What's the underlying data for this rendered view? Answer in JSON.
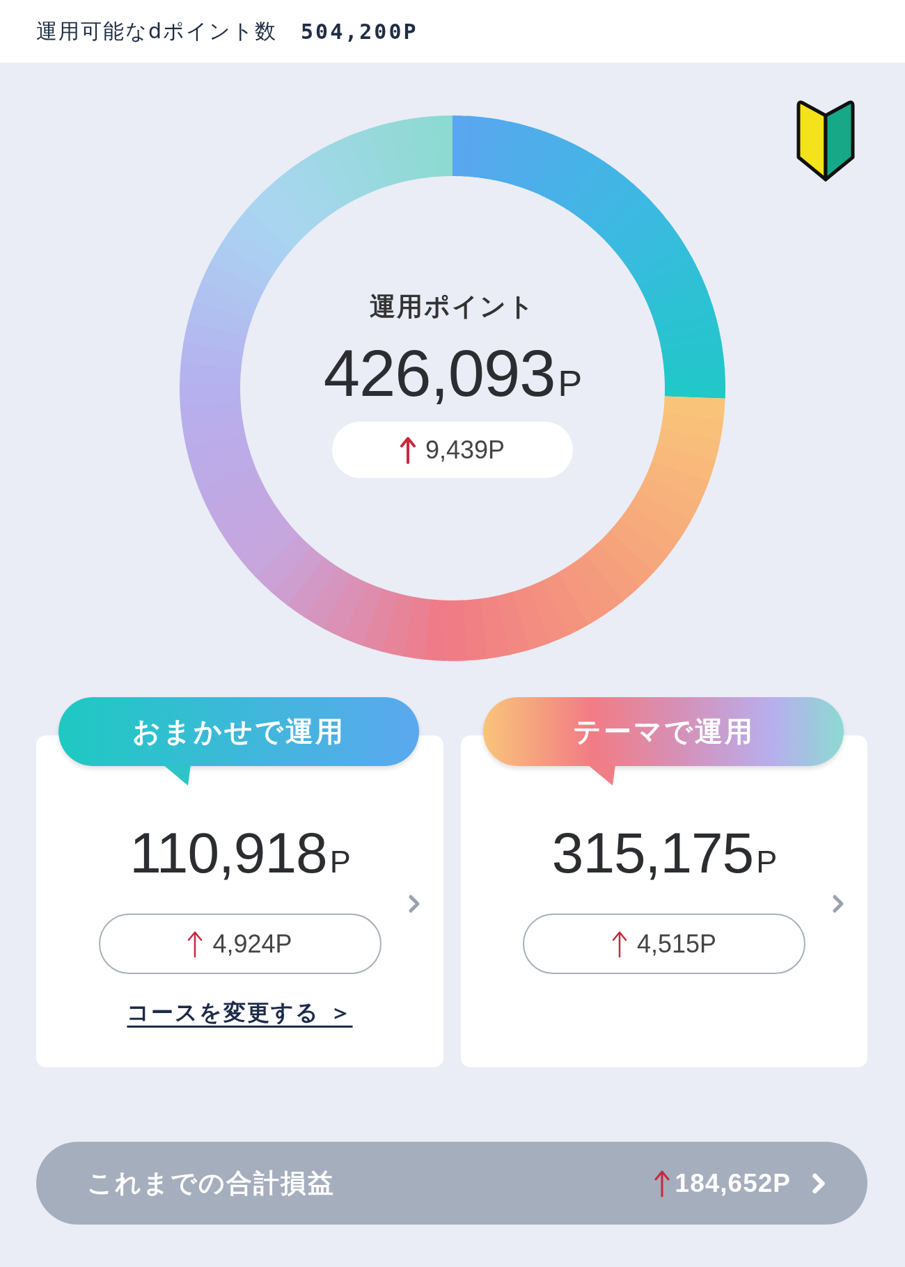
{
  "header": {
    "label": "運用可能なdポイント数",
    "value": "504,200P"
  },
  "summary": {
    "label": "運用ポイント",
    "value": "426,093",
    "unit": "P",
    "change": "9,439P"
  },
  "cards": [
    {
      "title": "おまかせで運用",
      "value": "110,918",
      "unit": "P",
      "change": "4,924P",
      "link": "コースを変更する ＞"
    },
    {
      "title": "テーマで運用",
      "value": "315,175",
      "unit": "P",
      "change": "4,515P"
    }
  ],
  "total": {
    "label": "これまでの合計損益",
    "value": "184,652P"
  }
}
